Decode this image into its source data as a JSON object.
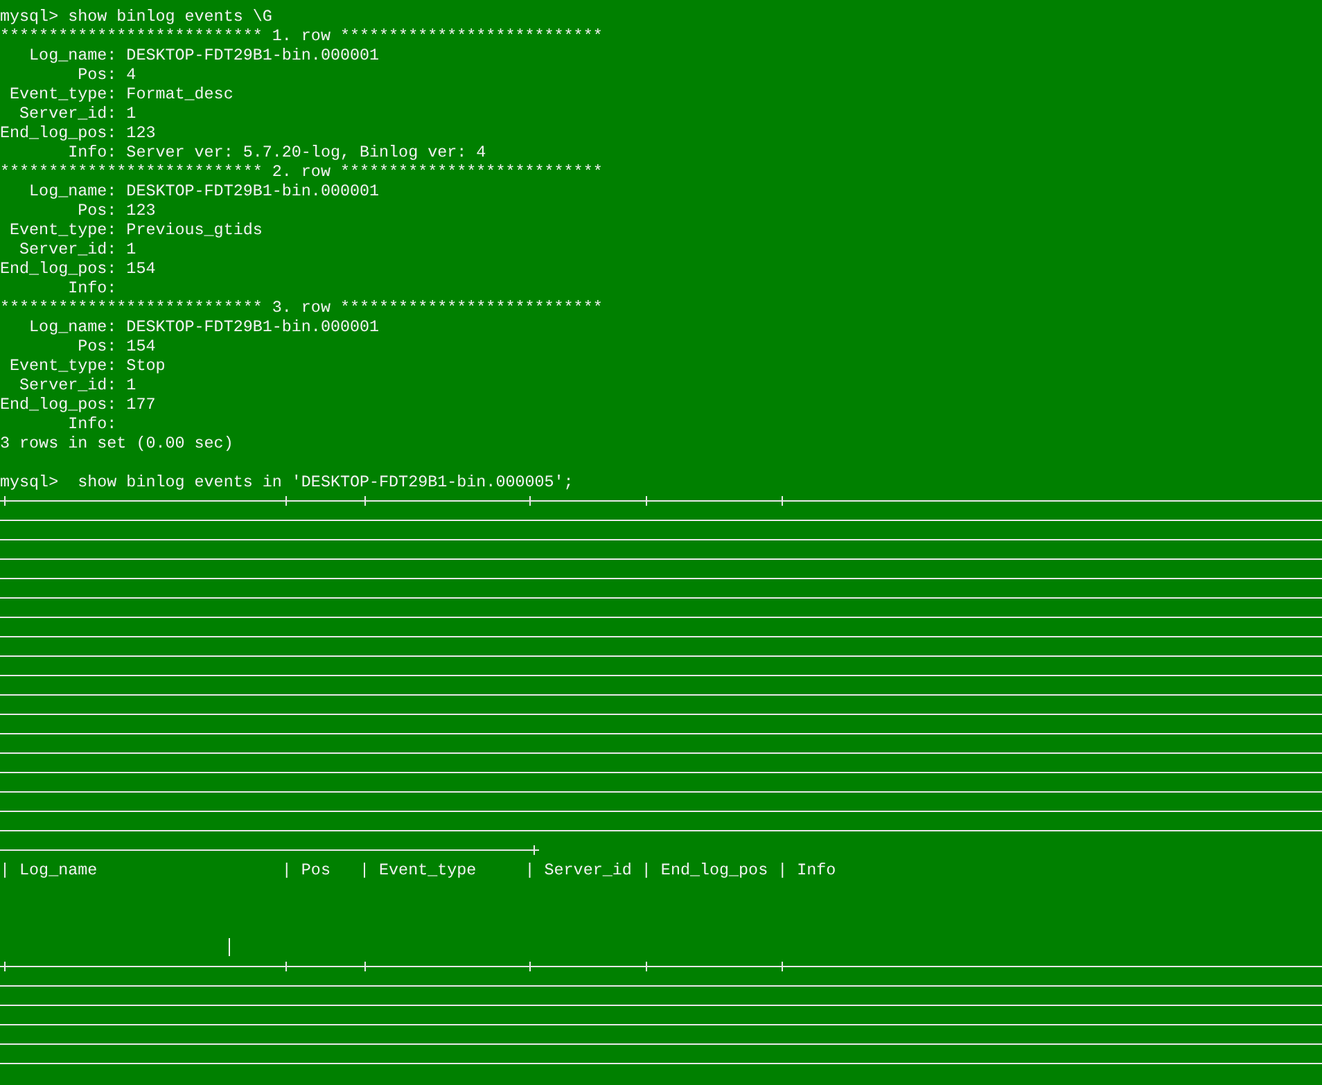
{
  "terminal": {
    "output_lines": [
      "mysql> show binlog events \\G",
      "*************************** 1. row ***************************",
      "   Log_name: DESKTOP-FDT29B1-bin.000001",
      "        Pos: 4",
      " Event_type: Format_desc",
      "  Server_id: 1",
      "End_log_pos: 123",
      "       Info: Server ver: 5.7.20-log, Binlog ver: 4",
      "*************************** 2. row ***************************",
      "   Log_name: DESKTOP-FDT29B1-bin.000001",
      "        Pos: 123",
      " Event_type: Previous_gtids",
      "  Server_id: 1",
      "End_log_pos: 154",
      "       Info:",
      "*************************** 3. row ***************************",
      "   Log_name: DESKTOP-FDT29B1-bin.000001",
      "        Pos: 154",
      " Event_type: Stop",
      "  Server_id: 1",
      "End_log_pos: 177",
      "       Info:",
      "3 rows in set (0.00 sec)"
    ],
    "command": "mysql>  show binlog events in 'DESKTOP-FDT29B1-bin.000005';",
    "table_header": "| Log_name                   | Pos   | Event_type     | Server_id | End_log_pos | Info"
  }
}
